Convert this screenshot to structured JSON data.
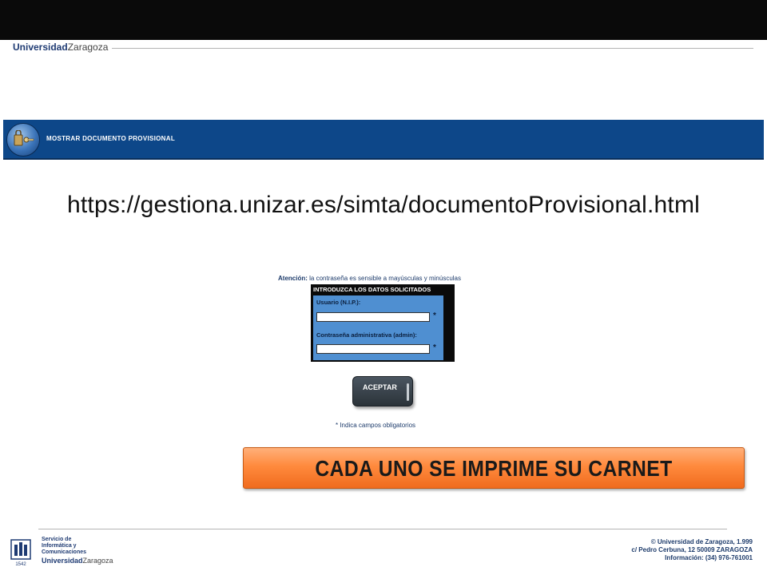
{
  "header": {
    "logo_bold": "Universidad",
    "logo_light": "Zaragoza"
  },
  "banner": {
    "title": "MOSTRAR DOCUMENTO PROVISIONAL",
    "icon": "key-lock-icon"
  },
  "url_text": "https://gestiona.unizar.es/simta/documentoProvisional.html",
  "form": {
    "notice_bold": "Atención:",
    "notice_text": "la contraseña es sensible a mayúsculas y minúsculas",
    "heading": "INTRODUZCA LOS DATOS SOLICITADOS",
    "user_label": "Usuario (N.I.P.):",
    "user_value": "",
    "password_label": "Contraseña administrativa (admin):",
    "password_value": "",
    "required_mark": "*",
    "accept_label": "ACEPTAR",
    "required_note": "* Indica campos obligatorios"
  },
  "callout": {
    "text": "CADA UNO SE IMPRIME SU CARNET"
  },
  "footer": {
    "service_line1": "Servicio de",
    "service_line2": "Informática y",
    "service_line3": "Comunicaciones",
    "logo_bold": "Universidad",
    "logo_light": "Zaragoza",
    "crest_year": "1542",
    "copyright": "© Universidad de Zaragoza, 1.999",
    "address": "c/ Pedro Cerbuna, 12 50009 ZARAGOZA",
    "info": "Información: (34) 976-761001"
  },
  "colors": {
    "banner_blue": "#0d4789",
    "form_blue": "#4f8fd1",
    "callout_orange": "#ff8a3d"
  }
}
